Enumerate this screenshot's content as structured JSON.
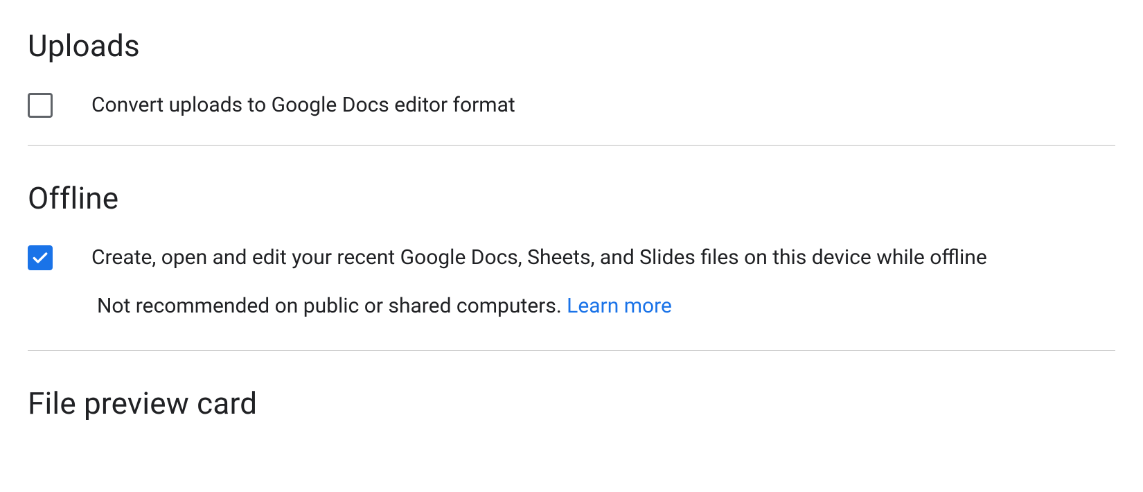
{
  "uploads": {
    "heading": "Uploads",
    "convert_label": "Convert uploads to Google Docs editor format",
    "convert_checked": false
  },
  "offline": {
    "heading": "Offline",
    "enable_label": "Create, open and edit your recent Google Docs, Sheets, and Slides files on this device while offline",
    "enable_checked": true,
    "hint_text": "Not recommended on public or shared computers. ",
    "learn_more_label": "Learn more"
  },
  "file_preview": {
    "heading": "File preview card"
  },
  "colors": {
    "accent": "#1a73e8"
  }
}
